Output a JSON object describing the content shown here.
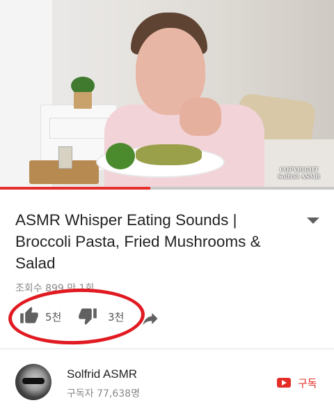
{
  "video": {
    "watermark_line1": "COPYRIGHT",
    "watermark_line2": "Solfrid ASMR",
    "progress": 0.45
  },
  "title": "ASMR Whisper Eating Sounds | Broccoli Pasta, Fried Mushrooms & Salad",
  "views": "조회수 899 만 1회",
  "actions": {
    "like_count": "5천",
    "dislike_count": "3천",
    "like_icon": "thumbs-up-icon",
    "dislike_icon": "thumbs-down-icon",
    "share_icon": "share-icon"
  },
  "channel": {
    "name": "Solfrid ASMR",
    "subscribers": "구독자 77,638명",
    "subscribe_label": "구독"
  },
  "colors": {
    "accent": "#e52d27",
    "annotation": "#e11a22"
  }
}
